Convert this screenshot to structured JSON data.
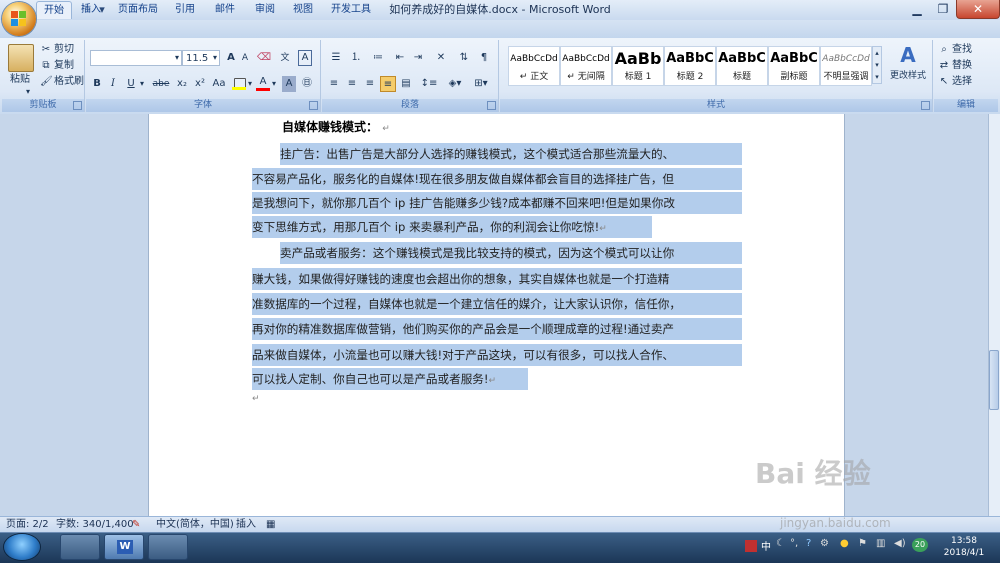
{
  "window": {
    "title": "如何养成好的自媒体.docx - Microsoft Word",
    "minimize_icon": "minimize-icon",
    "maximize_icon": "restore-icon",
    "close_icon": "close-icon"
  },
  "quick_access": [
    "save-icon",
    "undo-icon",
    "redo-icon",
    "customize-icon"
  ],
  "tabs": [
    "开始",
    "插入",
    "页面布局",
    "引用",
    "邮件",
    "审阅",
    "视图",
    "开发工具"
  ],
  "active_tab": "开始",
  "ribbon": {
    "clipboard": {
      "label": "剪贴板",
      "paste": "粘贴",
      "cut": "剪切",
      "copy": "复制",
      "format_painter": "格式刷"
    },
    "font": {
      "label": "字体",
      "font_name": "",
      "font_size": "11.5",
      "bold": "B",
      "italic": "I",
      "underline": "U",
      "strike": "abe",
      "subscript": "x₂",
      "superscript": "x²",
      "change_case": "Aa",
      "grow": "A",
      "shrink": "A",
      "char_border": "A",
      "font_color": "A",
      "highlight_color": "#ffff00",
      "font_color_value": "#ff0000"
    },
    "paragraph": {
      "label": "段落"
    },
    "styles": {
      "label": "样式",
      "items": [
        {
          "sample": "AaBbCcDd",
          "name": "↵ 正文"
        },
        {
          "sample": "AaBbCcDd",
          "name": "↵ 无间隔"
        },
        {
          "sample": "AaBb",
          "name": "标题 1"
        },
        {
          "sample": "AaBbC",
          "name": "标题 2"
        },
        {
          "sample": "AaBbC",
          "name": "标题"
        },
        {
          "sample": "AaBbC",
          "name": "副标题"
        },
        {
          "sample": "AaBbCcDd",
          "name": "不明显强调"
        }
      ],
      "change_styles": "更改样式"
    },
    "editing": {
      "label": "编辑",
      "find": "查找",
      "replace": "替换",
      "select": "选择"
    }
  },
  "document": {
    "heading": "自媒体赚钱模式：",
    "lines": [
      "挂广告：出售广告是大部分人选择的赚钱模式，这个模式适合那些流量大的、",
      "不容易产品化，服务化的自媒体!现在很多朋友做自媒体都会盲目的选择挂广告，但",
      "是我想问下，就你那几百个 ip 挂广告能赚多少钱?成本都赚不回来吧!但是如果你改",
      "变下思维方式，用那几百个 ip 来卖暴利产品，你的利润会让你吃惊!",
      "卖产品或者服务：这个赚钱模式是我比较支持的模式，因为这个模式可以让你",
      "赚大钱，如果做得好赚钱的速度也会超出你的想象，其实自媒体也就是一个打造精",
      "准数据库的一个过程，自媒体也就是一个建立信任的媒介，让大家认识你，信任你，",
      "再对你的精准数据库做营销，他们购买你的产品会是一个顺理成章的过程!通过卖产",
      "品来做自媒体，小流量也可以赚大钱!对于产品这块，可以有很多，可以找人合作、",
      "可以找人定制、你自己也可以是产品或者服务!"
    ],
    "paragraph_mark": "↵",
    "selection_color": "#b3cdec"
  },
  "status": {
    "page": "页面: 2/2",
    "words": "字数: 340/1,400",
    "language": "中文(简体，中国)",
    "insert_mode": "插入"
  },
  "taskbar": {
    "time": "13:58",
    "date": "2018/4/1",
    "ime": "中",
    "badge": "20"
  },
  "watermark": {
    "text": "Bai 经验",
    "url": "jingyan.baidu.com"
  }
}
